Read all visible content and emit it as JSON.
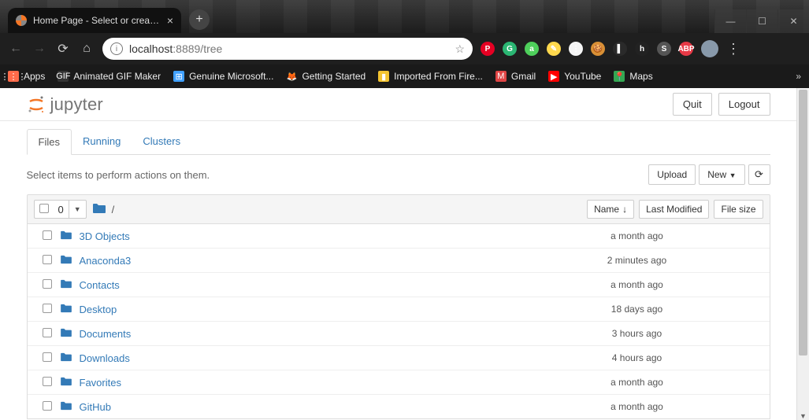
{
  "browser": {
    "tab_title": "Home Page - Select or create a n",
    "url_host": "localhost",
    "url_port_path": ":8889/tree",
    "bookmarks": [
      {
        "label": "Apps",
        "icon": "⋮⋮⋮",
        "color": "#ff6b4a"
      },
      {
        "label": "Animated GIF Maker",
        "icon": "GIF",
        "color": "#333"
      },
      {
        "label": "Genuine Microsoft...",
        "icon": "⊞",
        "color": "#40a0ff"
      },
      {
        "label": "Getting Started",
        "icon": "🦊",
        "color": "transparent"
      },
      {
        "label": "Imported From Fire...",
        "icon": "▮",
        "color": "#f4c430"
      },
      {
        "label": "Gmail",
        "icon": "M",
        "color": "#e04545"
      },
      {
        "label": "YouTube",
        "icon": "▶",
        "color": "#ff0000"
      },
      {
        "label": "Maps",
        "icon": "📍",
        "color": "#34a853"
      }
    ],
    "ext_badges": [
      {
        "bg": "#e60023",
        "txt": "P"
      },
      {
        "bg": "#2bb673",
        "txt": "G"
      },
      {
        "bg": "#4ecf5b",
        "txt": "a"
      },
      {
        "bg": "#ffd84d",
        "txt": "✎"
      },
      {
        "bg": "#f5f5f5",
        "txt": "⋮"
      },
      {
        "bg": "#d99036",
        "txt": "🍪"
      },
      {
        "bg": "#2a2a2a",
        "txt": "▌"
      },
      {
        "bg": "#222",
        "txt": "h"
      },
      {
        "bg": "#555",
        "txt": "S"
      },
      {
        "bg": "#e63946",
        "txt": "ABP"
      }
    ]
  },
  "jupyter": {
    "brand": "jupyter",
    "quit": "Quit",
    "logout": "Logout",
    "tabs": [
      "Files",
      "Running",
      "Clusters"
    ],
    "active_tab": 0,
    "hint": "Select items to perform actions on them.",
    "upload": "Upload",
    "new": "New",
    "selected_count": "0",
    "breadcrumb": "/",
    "col_name": "Name",
    "col_modified": "Last Modified",
    "col_size": "File size",
    "items": [
      {
        "name": "3D Objects",
        "modified": "a month ago"
      },
      {
        "name": "Anaconda3",
        "modified": "2 minutes ago"
      },
      {
        "name": "Contacts",
        "modified": "a month ago"
      },
      {
        "name": "Desktop",
        "modified": "18 days ago"
      },
      {
        "name": "Documents",
        "modified": "3 hours ago"
      },
      {
        "name": "Downloads",
        "modified": "4 hours ago"
      },
      {
        "name": "Favorites",
        "modified": "a month ago"
      },
      {
        "name": "GitHub",
        "modified": "a month ago"
      }
    ]
  }
}
